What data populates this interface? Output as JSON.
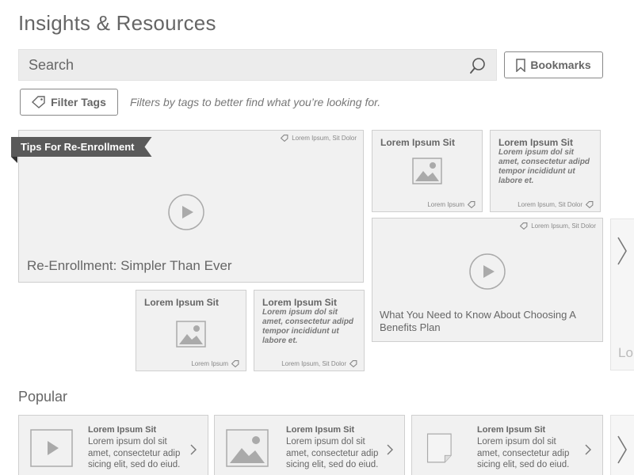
{
  "page": {
    "title": "Insights & Resources"
  },
  "search": {
    "placeholder": "Search"
  },
  "toolbar": {
    "bookmarks_label": "Bookmarks",
    "filter_label": "Filter Tags",
    "filter_hint": "Filters by tags to better find what you’re looking for."
  },
  "featured": {
    "ribbon": "Tips For Re-Enrollment",
    "main_video": {
      "title": "Re-Enrollment: Simpler Than Ever",
      "tag": "Lorem Ipsum, Sit Dolor"
    },
    "card_a": {
      "title": "Lorem Ipsum Sit",
      "tag": "Lorem Ipsum"
    },
    "card_b": {
      "title": "Lorem Ipsum Sit",
      "body": "Lorem ipsum dol sit amet, consectetur adipd tempor incididunt ut labore et.",
      "tag": "Lorem Ipsum, Sit Dolor"
    },
    "video_b": {
      "title": "What You Need to Know About Choosing A Benefits Plan",
      "tag": "Lorem Ipsum, Sit Dolor"
    },
    "card_c": {
      "title": "Lorem Ipsum Sit",
      "tag": "Lorem Ipsum"
    },
    "card_d": {
      "title": "Lorem Ipsum Sit",
      "body": "Lorem ipsum dol sit amet, consectetur adipd tempor incididunt ut labore et.",
      "tag": "Lorem Ipsum, Sit Dolor"
    },
    "peek_text": "Lo"
  },
  "popular": {
    "heading": "Popular",
    "items": [
      {
        "title": "Lorem Ipsum Sit",
        "text": "Lorem ipsum dol sit amet, consectetur adip sicing elit, sed do eiud.",
        "thumb": "video-icon"
      },
      {
        "title": "Lorem Ipsum Sit",
        "text": "Lorem ipsum dol sit amet, consectetur adip sicing elit, sed do eiud.",
        "thumb": "image-icon"
      },
      {
        "title": "Lorem Ipsum Sit",
        "text": "Lorem ipsum dol sit amet, consectetur adip sicing elit, sed do eiud.",
        "thumb": "document-icon"
      }
    ]
  },
  "icons": {
    "search": "search-icon",
    "bookmark": "bookmark-icon",
    "tag": "tag-icon",
    "play": "play-icon",
    "image": "image-placeholder-icon",
    "next": "chevron-right-icon"
  },
  "colors": {
    "ribbon": "#5a5a5a",
    "card_bg": "#f1f1f1",
    "border": "#cfcfcf",
    "text": "#666666"
  }
}
